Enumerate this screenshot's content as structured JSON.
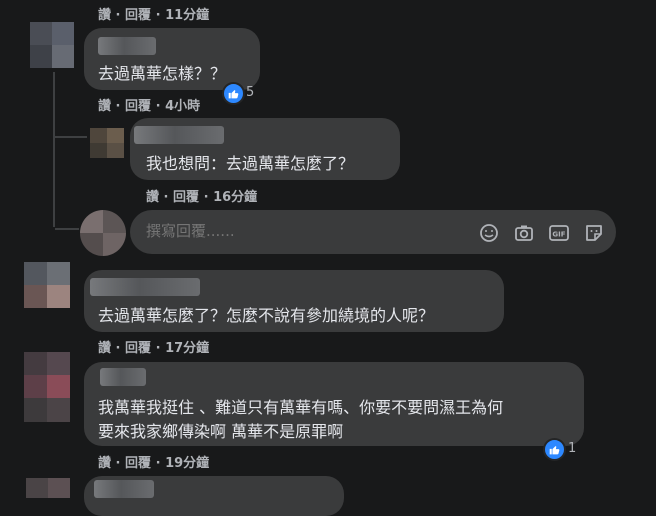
{
  "comments": [
    {
      "id": "c0",
      "meta": {
        "like": "讚",
        "reply": "回覆",
        "time": "11分鐘"
      }
    },
    {
      "id": "c1",
      "text": "去過萬華怎樣？？",
      "meta": {
        "like": "讚",
        "reply": "回覆",
        "time": "4小時"
      },
      "reaction": {
        "icon": "like-icon",
        "count": "5"
      }
    },
    {
      "id": "c1r1",
      "text": "我也想問：去過萬華怎麼了？",
      "meta": {
        "like": "讚",
        "reply": "回覆",
        "time": "16分鐘"
      }
    },
    {
      "id": "c2",
      "text": "去過萬華怎麼了？怎麼不說有參加繞境的人呢？",
      "meta": {
        "like": "讚",
        "reply": "回覆",
        "time": "17分鐘"
      }
    },
    {
      "id": "c3",
      "text_line1": "我萬華我挺住 、難道只有萬華有嗎、你要不要問濕王為何",
      "text_line2": "要來我家鄉傳染啊 萬華不是原罪啊",
      "meta": {
        "like": "讚",
        "reply": "回覆",
        "time": "19分鐘"
      },
      "reaction": {
        "icon": "like-icon",
        "count": "1"
      }
    }
  ],
  "composer": {
    "placeholder": "撰寫回覆......",
    "icons": [
      "emoji-icon",
      "camera-icon",
      "gif-icon",
      "sticker-icon"
    ]
  },
  "colors": {
    "background": "#18191a",
    "bubble": "#3a3b3c",
    "text": "#e4e6eb",
    "meta": "#b0b3b8",
    "like_blue": "#2d88ff"
  }
}
